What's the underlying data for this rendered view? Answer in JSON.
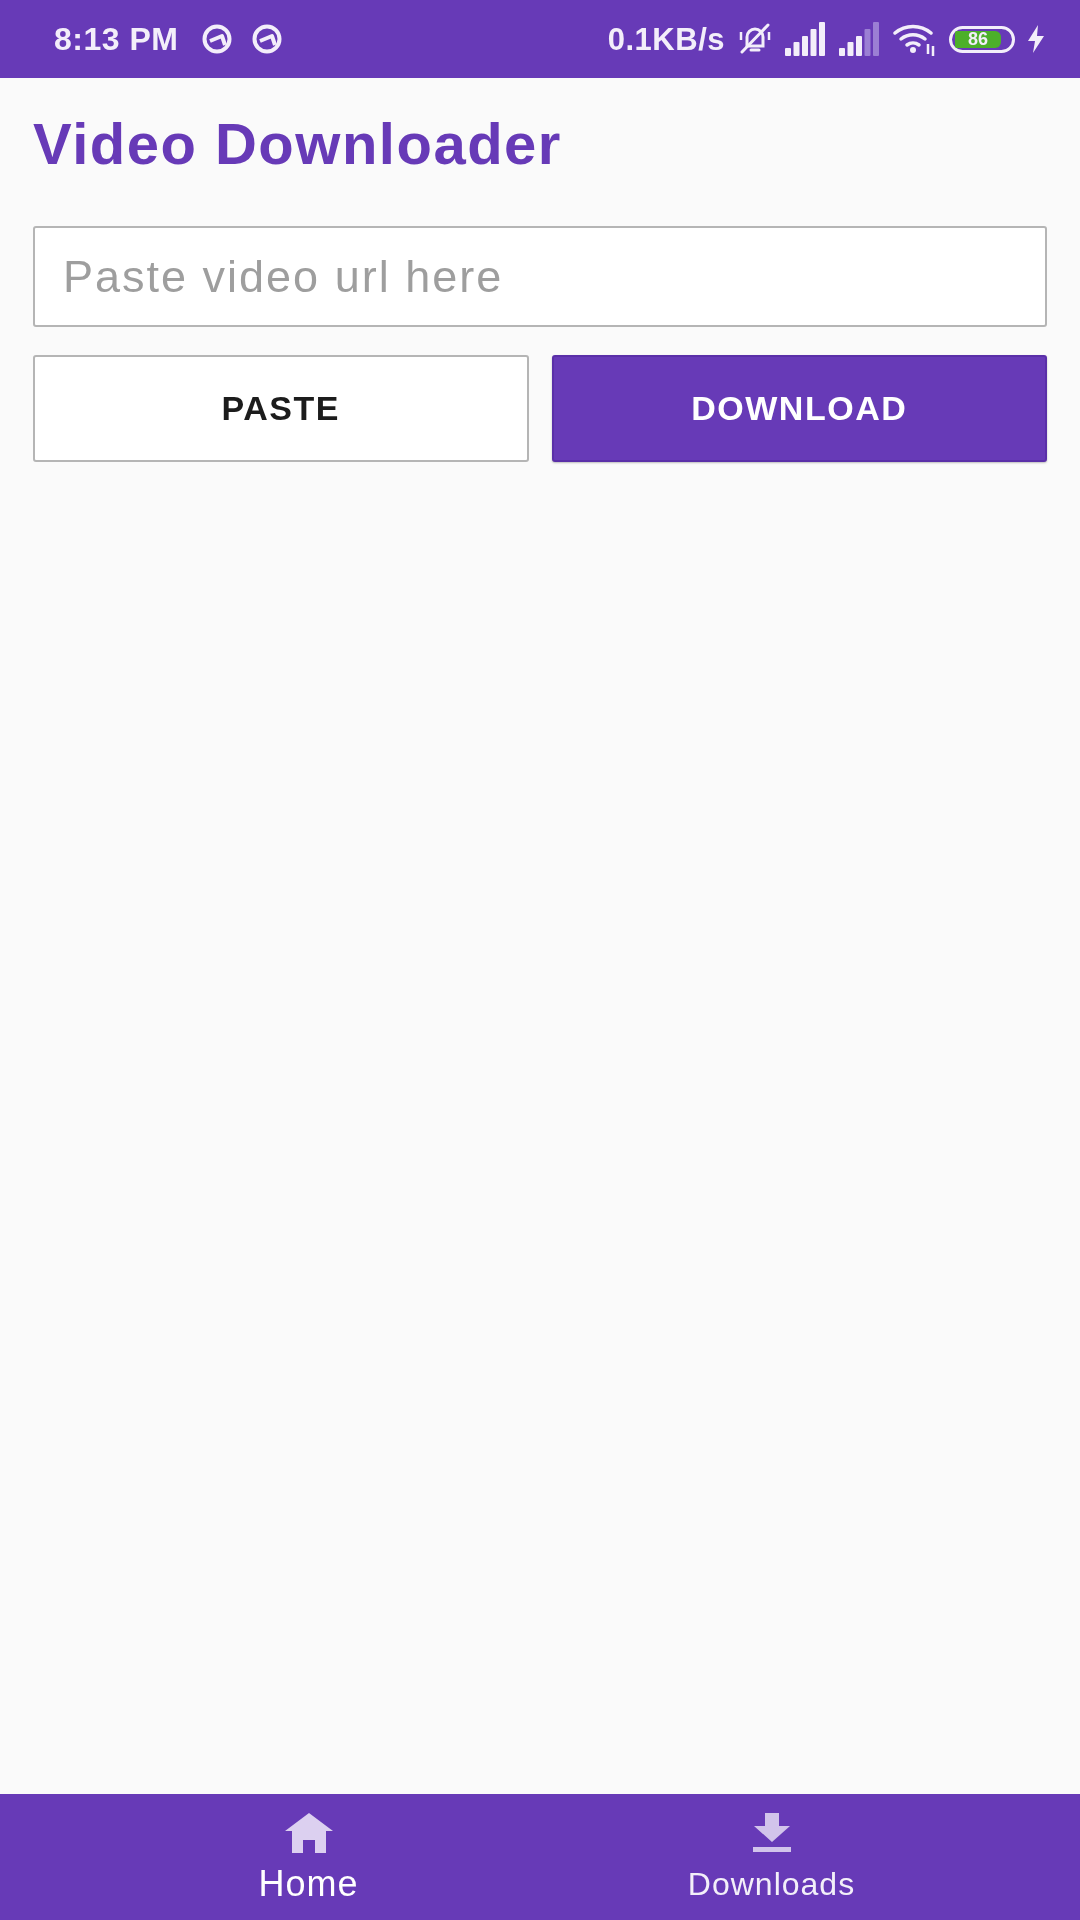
{
  "status_bar": {
    "time": "8:13 PM",
    "network_speed": "0.1KB/s",
    "battery": "86",
    "charging": true
  },
  "app_bar": {
    "title": "Video Downloader"
  },
  "url_field": {
    "placeholder": "Paste video url here"
  },
  "buttons": [
    {
      "label": "PASTE",
      "kind": "outlined"
    },
    {
      "label": "DOWNLOAD",
      "kind": "filled"
    }
  ],
  "bottom_nav": [
    {
      "label": "Home",
      "kind": "home",
      "selected": true
    },
    {
      "label": "Downloads",
      "kind": "download",
      "selected": false
    }
  ]
}
